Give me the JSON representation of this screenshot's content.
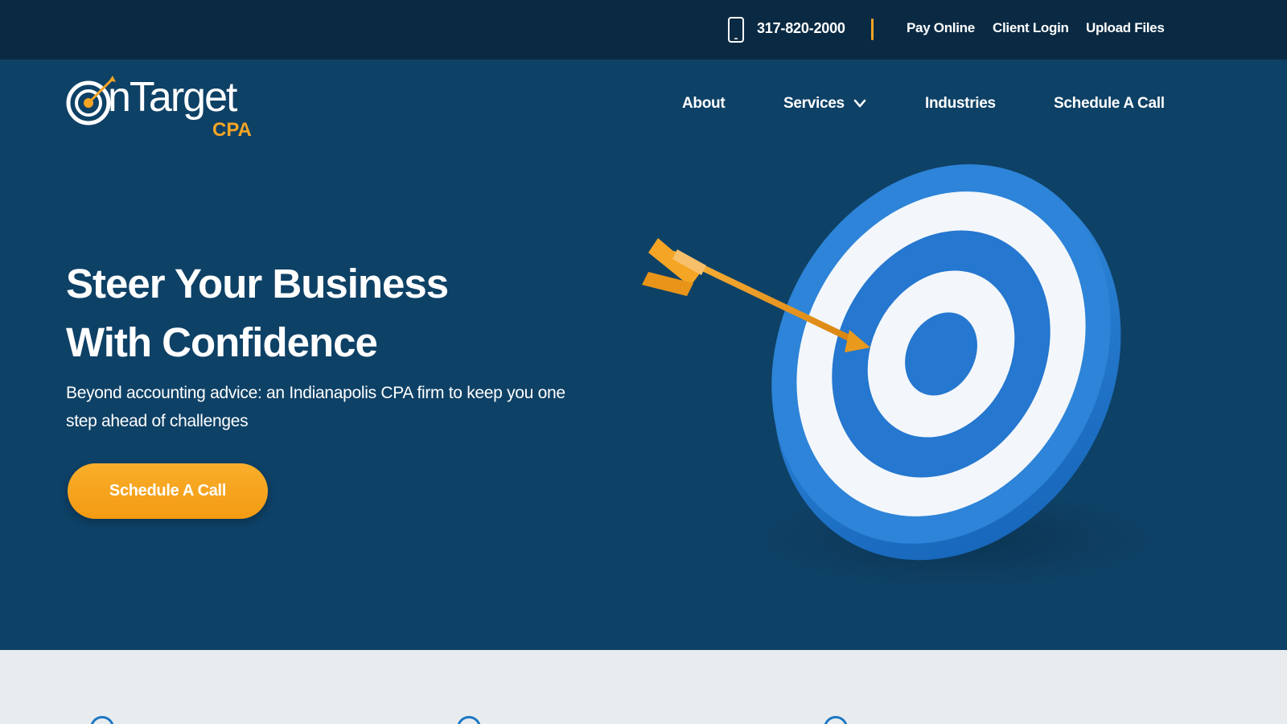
{
  "topbar": {
    "phone": "317-820-2000",
    "links": [
      "Pay Online",
      "Client Login",
      "Upload Files"
    ],
    "phone_icon": "smartphone-icon"
  },
  "logo": {
    "text": "nTarget",
    "sub": "CPA"
  },
  "nav": {
    "items": [
      "About",
      "Services",
      "Industries",
      "Schedule A Call"
    ]
  },
  "hero": {
    "title_line1": "Steer Your Business",
    "title_line2": "With Confidence",
    "subtitle_line1": "Beyond accounting advice: an Indianapolis CPA firm to keep you one",
    "subtitle_line2": "step ahead of challenges",
    "cta": "Schedule A Call"
  },
  "colors": {
    "hero_bg": "#0e4166",
    "topbar_bg": "#0a2a43",
    "accent": "#f5a524",
    "lower_bg": "#e8ecef"
  }
}
